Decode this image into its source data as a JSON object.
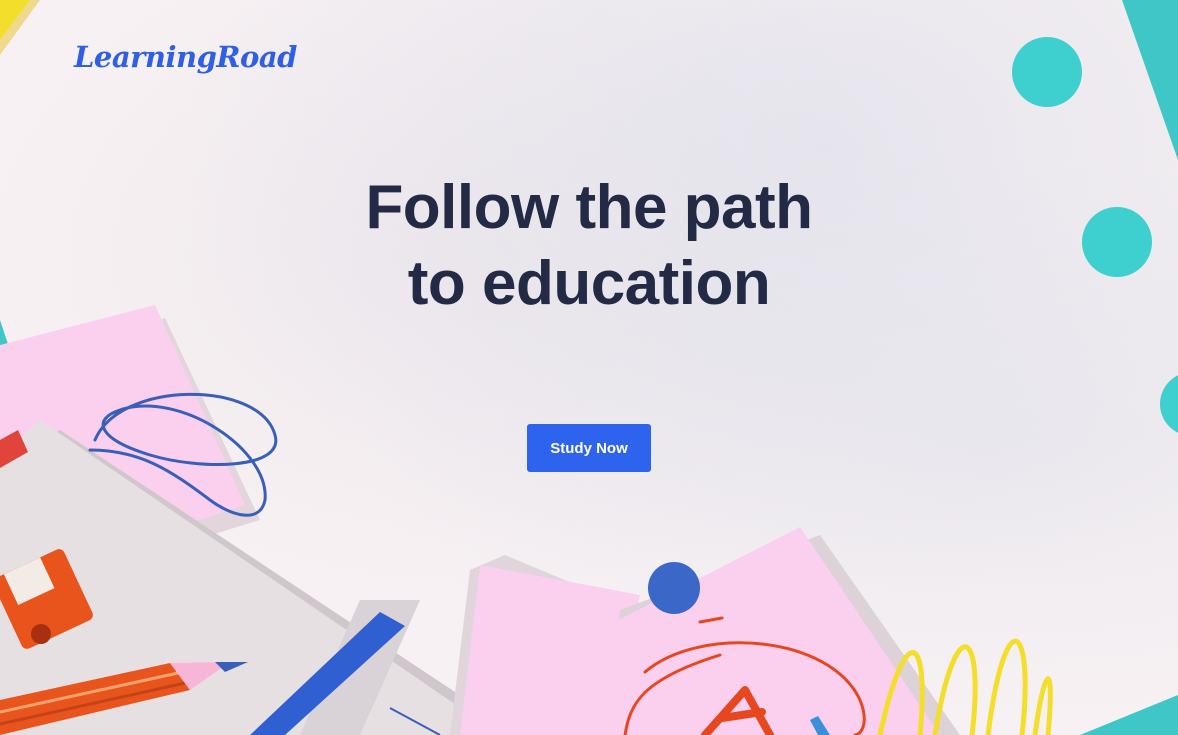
{
  "brand": {
    "logo_text": "LearningRoad"
  },
  "hero": {
    "title_line1": "Follow the path",
    "title_line2": "to education",
    "cta_label": "Study Now"
  },
  "colors": {
    "background": "#f7f1f3",
    "brand_blue": "#2f5fe6",
    "title": "#232a45",
    "button": "#2e63ee",
    "teal": "#3ecfcf",
    "pink": "#fbcfee",
    "yellow": "#f4de2c",
    "orange": "#e8541c"
  }
}
